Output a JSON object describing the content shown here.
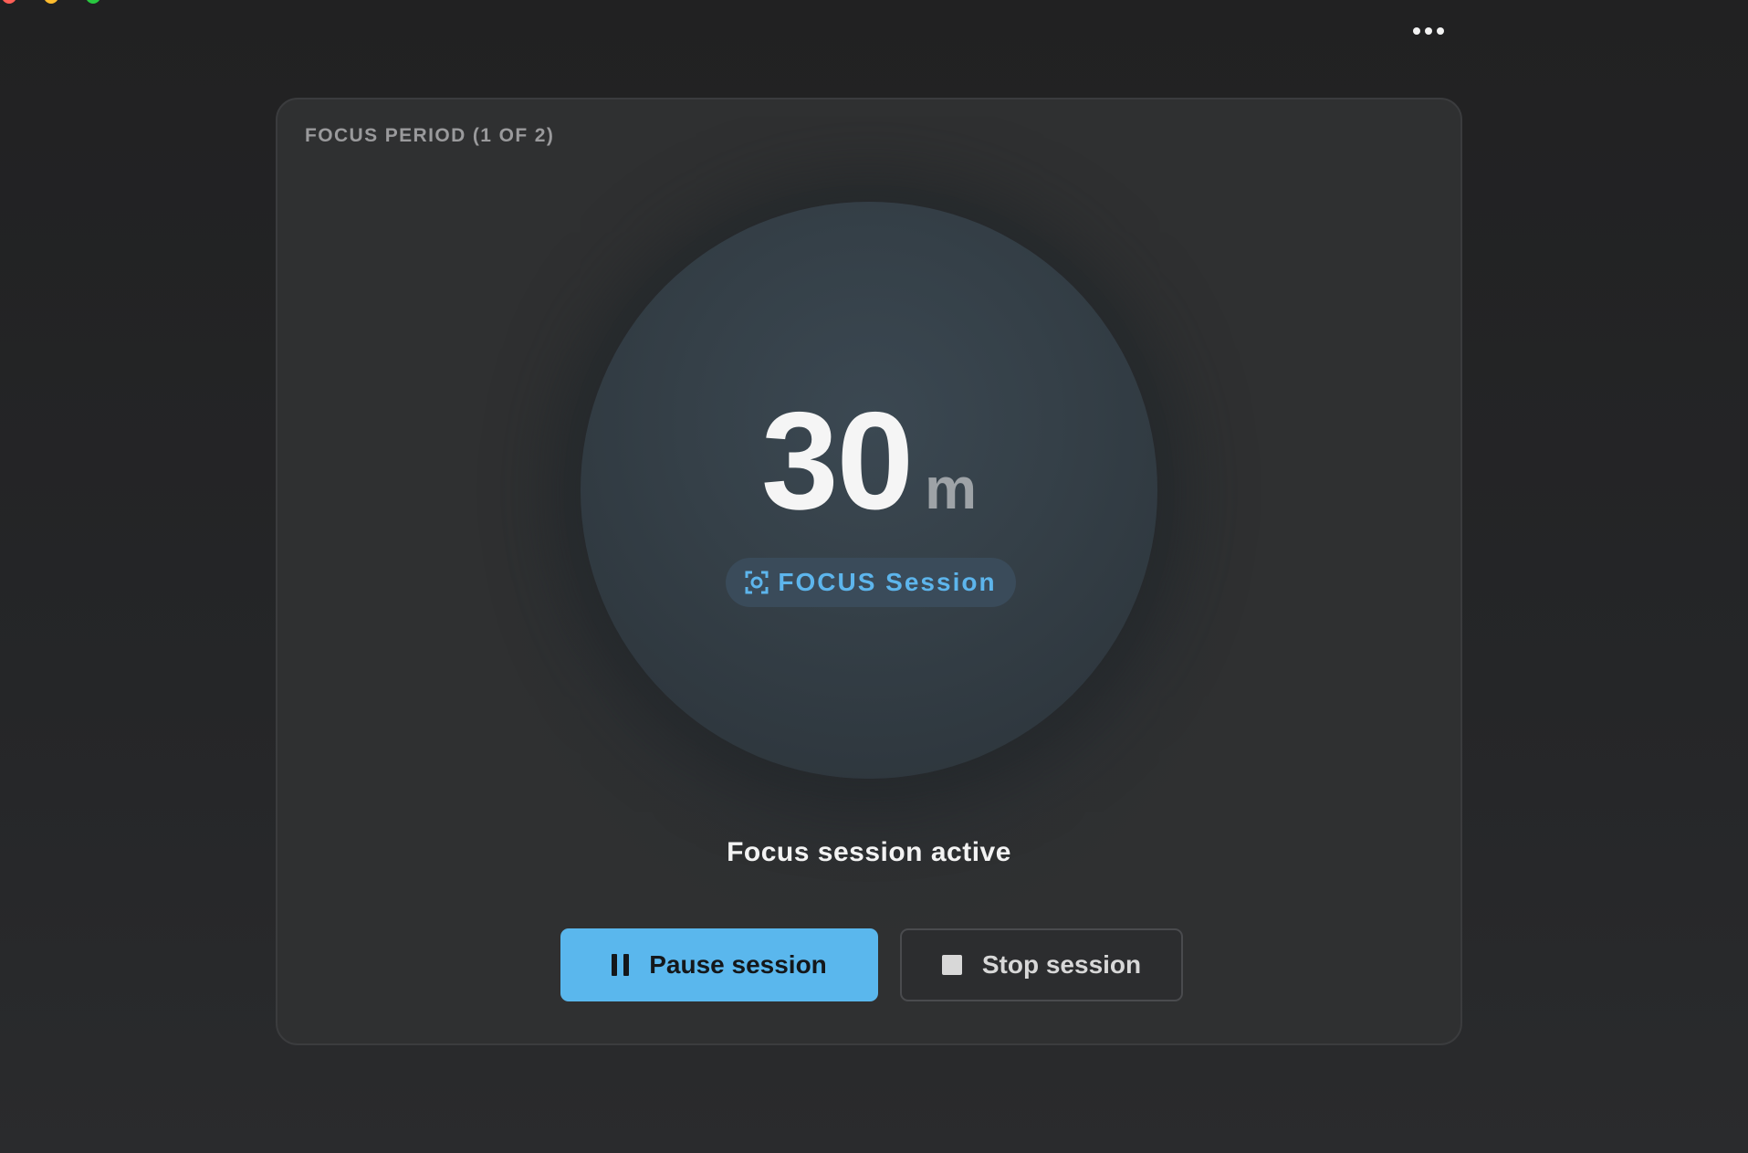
{
  "window": {
    "more_icon": "ellipsis-icon"
  },
  "card": {
    "period_label": "FOCUS PERIOD (1 OF 2)",
    "timer": {
      "value": "30",
      "unit": "m"
    },
    "badge": {
      "icon": "focus-target-icon",
      "label": "FOCUS Session"
    },
    "status": "Focus session active",
    "actions": {
      "pause_label": "Pause session",
      "pause_icon": "pause-icon",
      "stop_label": "Stop session",
      "stop_icon": "stop-icon"
    }
  },
  "colors": {
    "accent": "#5ab7ed",
    "card_bg": "#2f3031",
    "window_bg": "#222325",
    "badge_text": "#5db5ec"
  }
}
